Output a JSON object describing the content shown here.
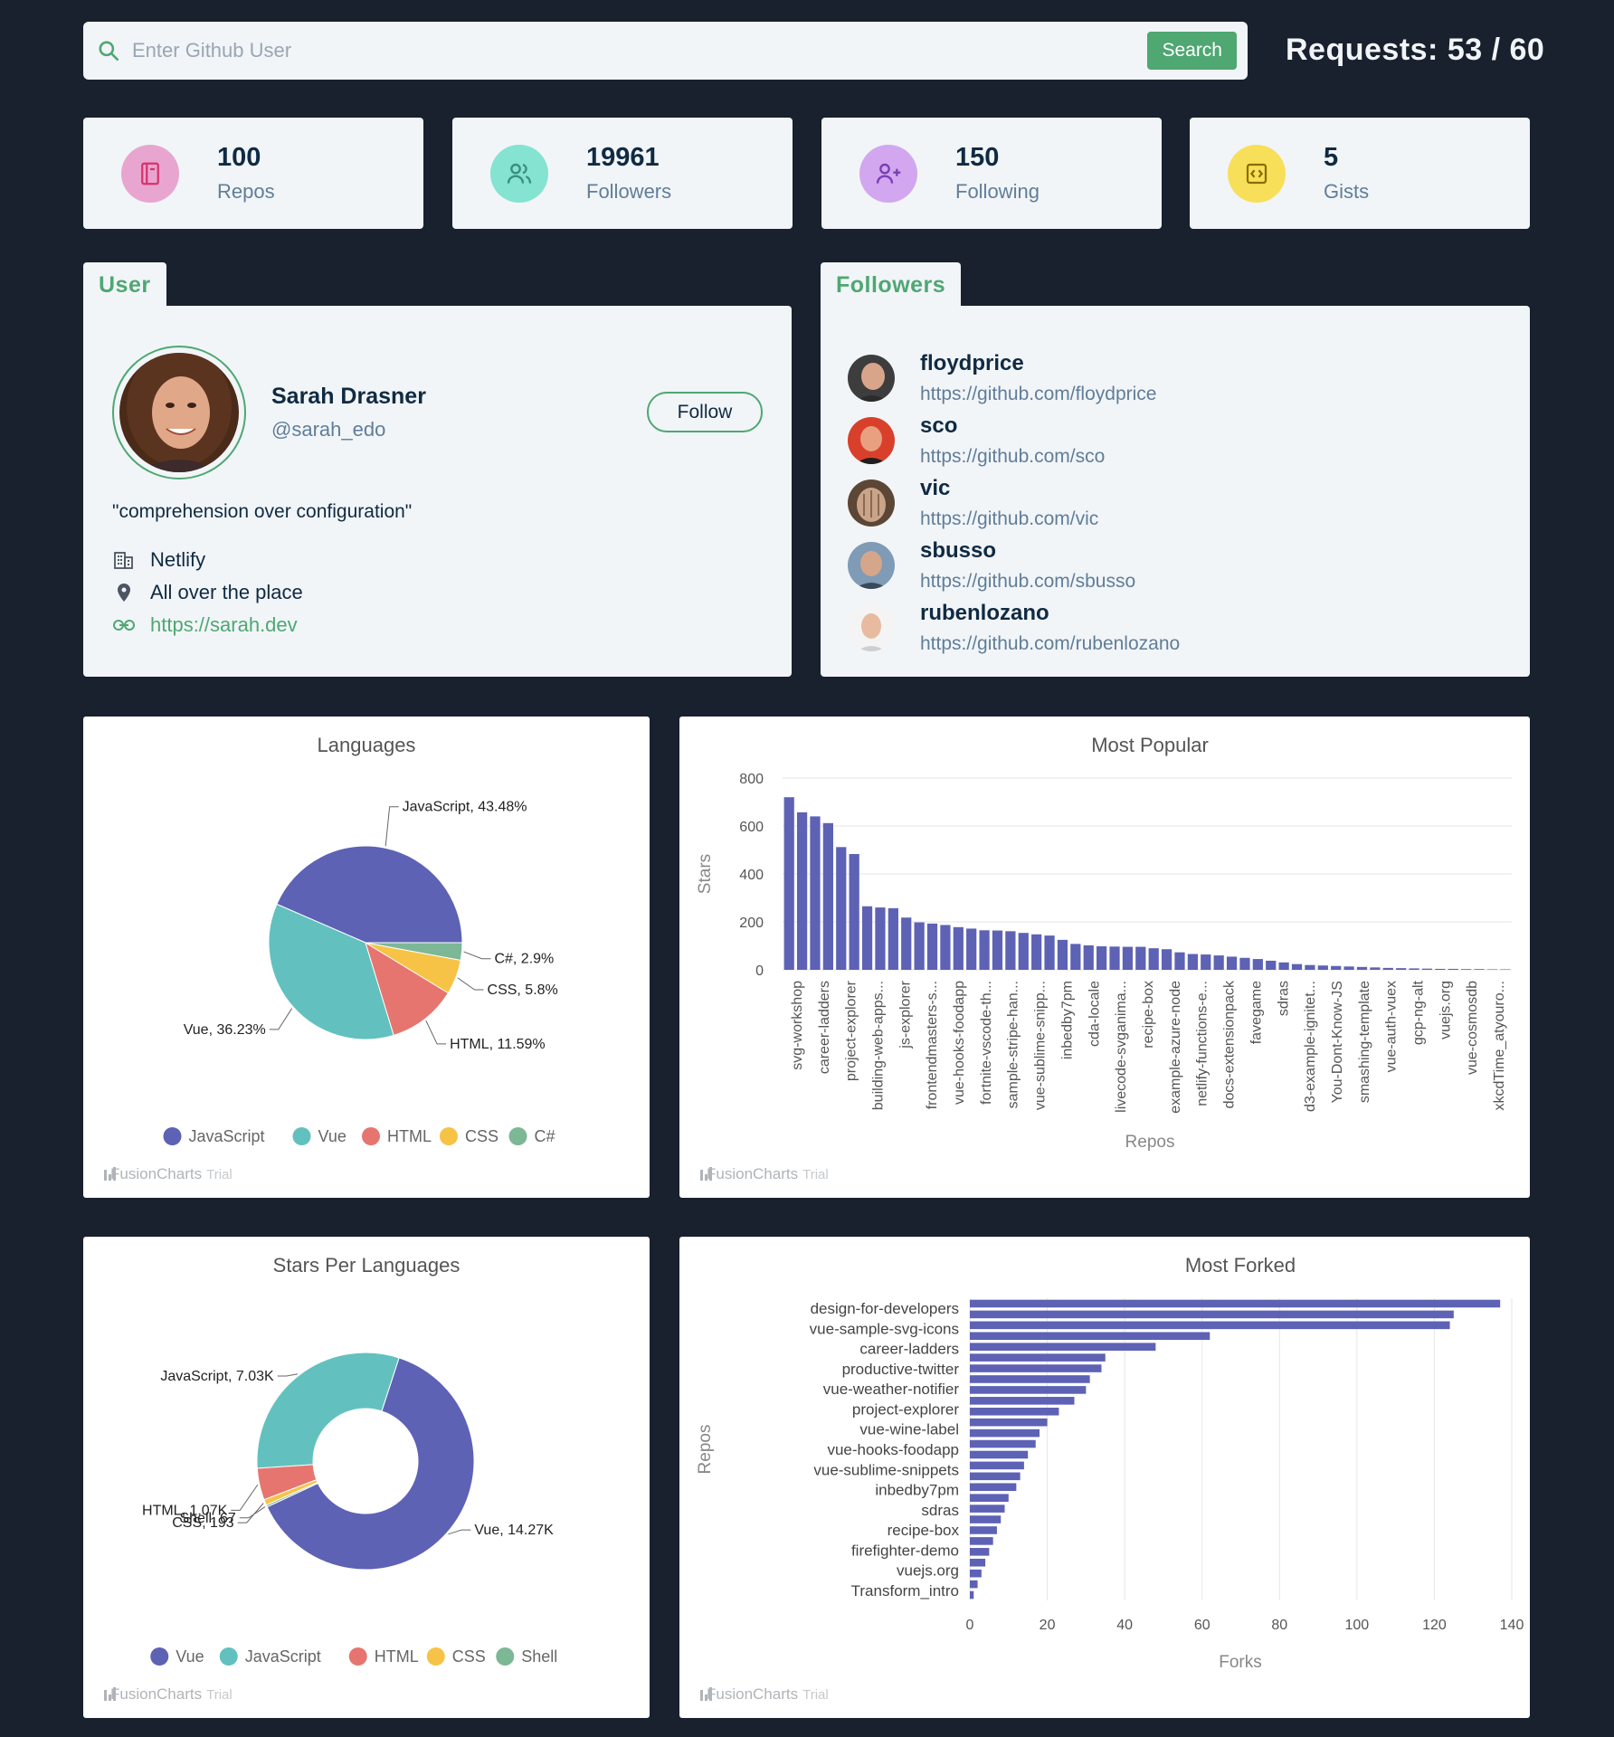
{
  "search": {
    "placeholder": "Enter Github User",
    "button_label": "Search"
  },
  "requests_text": "Requests: 53 / 60",
  "stats": [
    {
      "value": "100",
      "label": "Repos",
      "color": "#e8a5cf"
    },
    {
      "value": "19961",
      "label": "Followers",
      "color": "#84e3d1"
    },
    {
      "value": "150",
      "label": "Following",
      "color": "#d2a7f0"
    },
    {
      "value": "5",
      "label": "Gists",
      "color": "#f8df5a"
    }
  ],
  "user_tab": "User",
  "followers_tab": "Followers",
  "user": {
    "name": "Sarah Drasner",
    "handle": "@sarah_edo",
    "follow_label": "Follow",
    "bio": "\"comprehension over configuration\"",
    "company": "Netlify",
    "location": "All over the place",
    "blog": "https://sarah.dev"
  },
  "followers": [
    {
      "name": "floydprice",
      "url": "https://github.com/floydprice"
    },
    {
      "name": "sco",
      "url": "https://github.com/sco"
    },
    {
      "name": "vic",
      "url": "https://github.com/vic"
    },
    {
      "name": "sbusso",
      "url": "https://github.com/sbusso"
    },
    {
      "name": "rubenlozano",
      "url": "https://github.com/rubenlozano"
    }
  ],
  "watermark": {
    "name": "FusionCharts",
    "trial": "Trial"
  },
  "chart_data": [
    {
      "type": "pie",
      "title": "Languages",
      "slices": [
        {
          "name": "JavaScript",
          "value": 43.48,
          "label": "JavaScript, 43.48%",
          "color": "#5d62b5"
        },
        {
          "name": "Vue",
          "value": 36.23,
          "label": "Vue, 36.23%",
          "color": "#62c1bf"
        },
        {
          "name": "HTML",
          "value": 11.59,
          "label": "HTML, 11.59%",
          "color": "#e67570"
        },
        {
          "name": "CSS",
          "value": 5.8,
          "label": "CSS, 5.8%",
          "color": "#f7c346"
        },
        {
          "name": "C#",
          "value": 2.9,
          "label": "C#, 2.9%",
          "color": "#7cb796"
        }
      ],
      "legend": [
        "JavaScript",
        "Vue",
        "HTML",
        "CSS",
        "C#"
      ],
      "legend_position": "bottom"
    },
    {
      "type": "bar",
      "title": "Most Popular",
      "xlabel": "Repos",
      "ylabel": "Stars",
      "ylim": [
        0,
        800
      ],
      "yticks": [
        0,
        200,
        400,
        600,
        800
      ],
      "color": "#5d62b5",
      "values": [
        720,
        657,
        640,
        612,
        512,
        483,
        265,
        260,
        257,
        218,
        198,
        193,
        187,
        178,
        172,
        165,
        164,
        161,
        154,
        148,
        143,
        125,
        108,
        102,
        98,
        97,
        96,
        96,
        90,
        86,
        73,
        66,
        64,
        60,
        55,
        50,
        45,
        38,
        31,
        24,
        20,
        18,
        16,
        14,
        12,
        10,
        8,
        7,
        6,
        5,
        4,
        4,
        3,
        3,
        2,
        2
      ],
      "labels": [
        "svg-workshop",
        "career-ladders",
        "project-explorer",
        "building-web-apps...",
        "js-explorer",
        "frontendmasters-s...",
        "vue-hooks-foodapp",
        "fortnite-vscode-th...",
        "sample-stripe-han...",
        "vue-sublime-snipp...",
        "inbedby7pm",
        "cda-locale",
        "livecode-svganima...",
        "recipe-box",
        "example-azure-node",
        "netlify-functions-e...",
        "docs-extensionpack",
        "favegame",
        "sdras",
        "d3-example-ignitet...",
        "You-Dont-Know-JS",
        "smashing-template",
        "vue-auth-vuex",
        "gcp-ng-alt",
        "vuejs.org",
        "vue-cosmosdb",
        "xkcdTime_atyouro..."
      ],
      "grid": true
    },
    {
      "type": "pie",
      "title": "Stars Per Languages",
      "slices": [
        {
          "name": "Vue",
          "value": 14270,
          "label": "Vue, 14.27K",
          "color": "#5d62b5"
        },
        {
          "name": "JavaScript",
          "value": 7030,
          "label": "JavaScript, 7.03K",
          "color": "#62c1bf"
        },
        {
          "name": "HTML",
          "value": 1070,
          "label": "HTML, 1.07K",
          "color": "#e67570"
        },
        {
          "name": "CSS",
          "value": 193,
          "label": "CSS, 193",
          "color": "#f7c346"
        },
        {
          "name": "Shell",
          "value": 67,
          "label": "Shell, 67",
          "color": "#7cb796"
        }
      ],
      "legend": [
        "Vue",
        "JavaScript",
        "HTML",
        "CSS",
        "Shell"
      ],
      "legend_position": "bottom"
    },
    {
      "type": "bar",
      "title": "Most Forked",
      "xlabel": "Forks",
      "ylabel": "Repos",
      "xlim": [
        0,
        140
      ],
      "xticks": [
        0,
        20,
        40,
        60,
        80,
        100,
        120,
        140
      ],
      "color": "#5d62b5",
      "values": [
        137,
        125,
        124,
        62,
        48,
        35,
        34,
        31,
        30,
        27,
        23,
        20,
        18,
        17,
        15,
        14,
        13,
        12,
        10,
        9,
        8,
        7,
        6,
        5,
        4,
        3,
        2,
        1
      ],
      "labels": [
        "design-for-developers",
        "vue-sample-svg-icons",
        "career-ladders",
        "productive-twitter",
        "vue-weather-notifier",
        "project-explorer",
        "vue-wine-label",
        "vue-hooks-foodapp",
        "vue-sublime-snippets",
        "inbedby7pm",
        "sdras",
        "recipe-box",
        "firefighter-demo",
        "vuejs.org",
        "Transform_intro"
      ],
      "grid": true
    }
  ]
}
